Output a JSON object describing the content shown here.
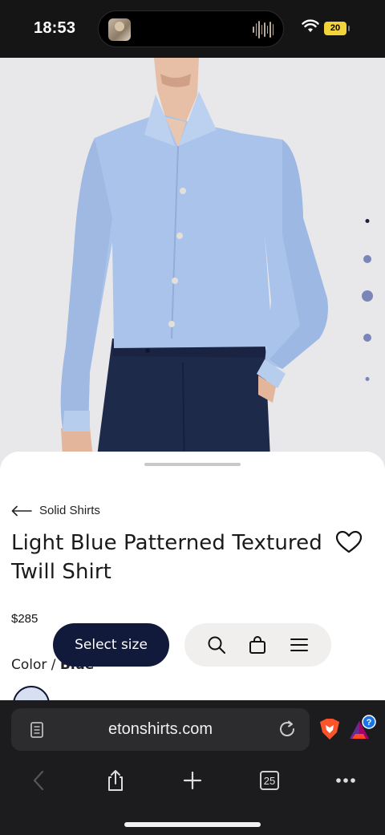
{
  "status": {
    "time": "18:53",
    "battery": "20"
  },
  "breadcrumb": {
    "label": "Solid Shirts"
  },
  "product": {
    "title": "Light Blue Patterned Textured Twill Shirt",
    "price": "$285",
    "color_label": "Color / ",
    "color_value": "Blue"
  },
  "actions": {
    "select_size": "Select size"
  },
  "browser": {
    "url": "etonshirts.com",
    "tab_count": "25",
    "badge": "?"
  },
  "icons": {
    "back": "arrow-left-icon",
    "favorite": "heart-icon",
    "search": "search-icon",
    "bag": "shopping-bag-icon",
    "menu": "hamburger-menu-icon",
    "reader": "reader-icon",
    "reload": "reload-icon",
    "brave": "brave-shield-icon",
    "share": "share-icon",
    "new_tab": "plus-icon",
    "more": "more-icon"
  },
  "colors": {
    "accent": "#121a3b",
    "shirt": "#a9c3ea",
    "trousers": "#1e2a4a"
  }
}
